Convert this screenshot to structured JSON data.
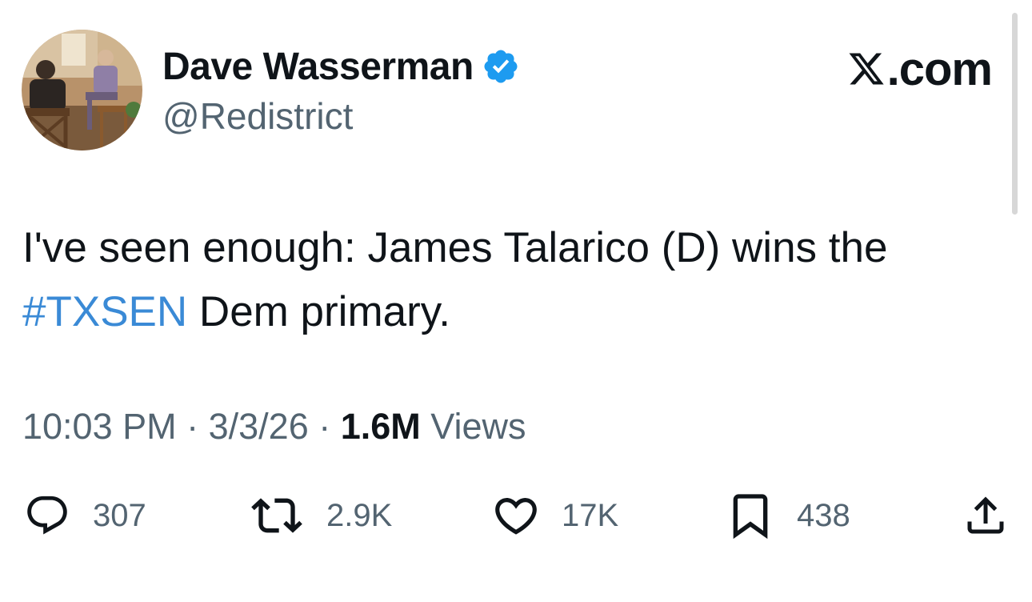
{
  "author": {
    "display_name": "Dave Wasserman",
    "handle": "@Redistrict",
    "verified_icon": "verified-badge-icon",
    "verified_color": "#1d9bf0"
  },
  "brand": {
    "label": ".com",
    "icon": "x-logo-icon"
  },
  "tweet": {
    "text_part1": "I've seen enough: James Talarico (D) wins the ",
    "hashtag": "#TXSEN",
    "text_part2": " Dem primary.",
    "hashtag_color": "#3a8ad6"
  },
  "meta": {
    "time": "10:03 PM",
    "separator": " · ",
    "date": "3/3/26",
    "views_count": "1.6M",
    "views_label": " Views"
  },
  "actions": {
    "reply": {
      "icon": "reply-icon",
      "count": "307"
    },
    "retweet": {
      "icon": "retweet-icon",
      "count": "2.9K"
    },
    "like": {
      "icon": "heart-icon",
      "count": "17K"
    },
    "bookmark": {
      "icon": "bookmark-icon",
      "count": "438"
    },
    "share": {
      "icon": "share-icon"
    }
  }
}
